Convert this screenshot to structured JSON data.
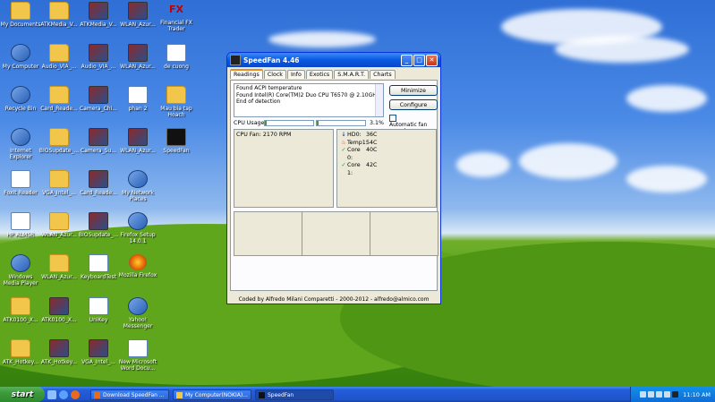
{
  "desktop": {
    "icons": [
      {
        "label": "My Documents",
        "icon": "folder-docs-icon"
      },
      {
        "label": "ATKMedia_V...",
        "icon": "folder-icon"
      },
      {
        "label": "ATKMedia_V...",
        "icon": "app-icon"
      },
      {
        "label": "WLAN_Azur...",
        "icon": "app-icon"
      },
      {
        "label": "Financial FX Trader",
        "icon": "fx-icon"
      },
      {
        "label": "My Computer",
        "icon": "computer-icon"
      },
      {
        "label": "Audio_VIA_...",
        "icon": "folder-icon"
      },
      {
        "label": "Audio_VIA_...",
        "icon": "app-icon"
      },
      {
        "label": "WLAN_Azur...",
        "icon": "app-icon"
      },
      {
        "label": "de cuong",
        "icon": "word-doc-icon"
      },
      {
        "label": "Recycle Bin",
        "icon": "recycle-bin-icon"
      },
      {
        "label": "Card_Reade...",
        "icon": "folder-icon"
      },
      {
        "label": "Camera_Chi...",
        "icon": "app-icon"
      },
      {
        "label": "phan 2",
        "icon": "word-doc-icon"
      },
      {
        "label": "Mau bia tap Hoach",
        "icon": "folder-icon"
      },
      {
        "label": "Internet Explorer",
        "icon": "ie-icon"
      },
      {
        "label": "BIOSupdate_...",
        "icon": "folder-icon"
      },
      {
        "label": "Camera_Su...",
        "icon": "app-icon"
      },
      {
        "label": "WLAN_Azur...",
        "icon": "app-icon"
      },
      {
        "label": "SpeedFan",
        "icon": "speedfan-icon"
      },
      {
        "label": "Foxit Reader",
        "icon": "foxit-icon"
      },
      {
        "label": "VGA_Intel_...",
        "icon": "folder-icon"
      },
      {
        "label": "Card_Reade...",
        "icon": "app-icon"
      },
      {
        "label": "My Network Places",
        "icon": "network-icon"
      },
      {
        "label": "HP ALMSR",
        "icon": "hp-icon"
      },
      {
        "label": "WLAN_Azur...",
        "icon": "folder-icon"
      },
      {
        "label": "BIOSupdate_...",
        "icon": "app-icon"
      },
      {
        "label": "Firefox Setup 14.0.1",
        "icon": "setup-icon"
      },
      {
        "label": "Windows Media Player",
        "icon": "media-player-icon"
      },
      {
        "label": "WLAN_Azur...",
        "icon": "folder-icon"
      },
      {
        "label": "KeyboardTest",
        "icon": "keyboard-icon"
      },
      {
        "label": "Mozilla Firefox",
        "icon": "firefox-icon"
      },
      {
        "label": "ATK0100_X...",
        "icon": "folder-icon"
      },
      {
        "label": "ATK0100_X...",
        "icon": "app-icon"
      },
      {
        "label": "UniKey",
        "icon": "unikey-icon"
      },
      {
        "label": "Yahoo! Messenger",
        "icon": "yahoo-icon"
      },
      {
        "label": "ATK_Hotkey...",
        "icon": "folder-icon"
      },
      {
        "label": "ATK_Hotkey...",
        "icon": "app-icon"
      },
      {
        "label": "VGA_Intel_...",
        "icon": "app-icon"
      },
      {
        "label": "New Microsoft Word Docu...",
        "icon": "word-doc-icon"
      }
    ]
  },
  "window": {
    "title": "SpeedFan 4.46",
    "tabs": [
      "Readings",
      "Clock",
      "Info",
      "Exotics",
      "S.M.A.R.T.",
      "Charts"
    ],
    "active_tab": "Readings",
    "log_lines": [
      "Found ACPI temperature",
      "Found Intel(R) Core(TM)2 Duo CPU T6570 @ 2.10GHz",
      "End of detection"
    ],
    "minimize_label": "Minimize",
    "configure_label": "Configure",
    "auto_fan_label": "Automatic fan speed",
    "cpu_usage_label": "CPU Usage",
    "cpu_usage_value": "3.1%",
    "cpu_usage_fraction": 0.031,
    "fan_reading": "CPU Fan: 2170 RPM",
    "temps": [
      {
        "name": "HD0:",
        "value": "36C",
        "icon": "arrow-down-icon",
        "color": "#1f4fc8"
      },
      {
        "name": "Temp1:",
        "value": "54C",
        "icon": "flame-icon",
        "color": "#d8541c"
      },
      {
        "name": "Core 0:",
        "value": "40C",
        "icon": "checkmark-icon",
        "color": "#2a9a2a"
      },
      {
        "name": "Core 1:",
        "value": "42C",
        "icon": "checkmark-icon",
        "color": "#2a9a2a"
      }
    ],
    "footer": "Coded by Alfredo Milani Comparetti - 2000-2012 - alfredo@almico.com"
  },
  "taskbar": {
    "start_label": "start",
    "tasks": [
      {
        "label": "Download SpeedFan ...",
        "icon": "firefox-icon"
      },
      {
        "label": "My Computer(NOKIA)...",
        "icon": "folder-icon"
      },
      {
        "label": "SpeedFan",
        "icon": "speedfan-icon"
      }
    ],
    "clock": "11:10 AM"
  }
}
